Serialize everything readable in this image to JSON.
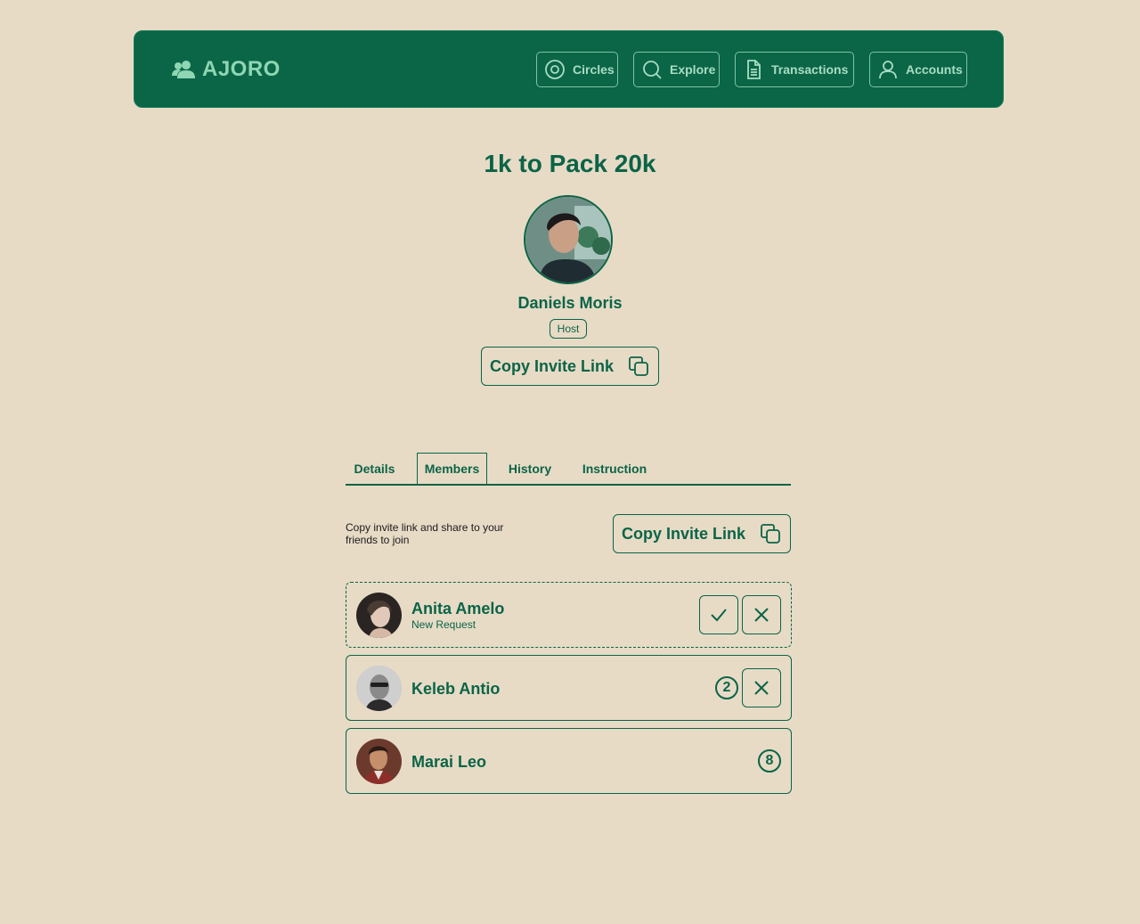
{
  "brand": {
    "name": "AJORO",
    "icon": "users-icon"
  },
  "nav": [
    {
      "label": "Circles",
      "icon": "circle-target-icon"
    },
    {
      "label": "Explore",
      "icon": "search-icon"
    },
    {
      "label": "Transactions",
      "icon": "document-icon"
    },
    {
      "label": "Accounts",
      "icon": "user-icon"
    }
  ],
  "circle": {
    "title": "1k to Pack 20k",
    "host_name": "Daniels Moris",
    "host_badge": "Host",
    "copy_invite_label": "Copy Invite Link"
  },
  "tabs": [
    {
      "label": "Details",
      "active": false
    },
    {
      "label": "Members",
      "active": true
    },
    {
      "label": "History",
      "active": false
    },
    {
      "label": "Instruction",
      "active": false
    }
  ],
  "members_panel": {
    "invite_hint": "Copy invite link and share to your friends to join",
    "copy_invite_label": "Copy Invite Link"
  },
  "members": [
    {
      "name": "Anita Amelo",
      "status": "New Request",
      "position": null
    },
    {
      "name": "Keleb Antio",
      "status": "",
      "position": "2"
    },
    {
      "name": "Marai Leo",
      "status": "",
      "position": "8"
    }
  ],
  "colors": {
    "background": "#e7dbc6",
    "primary": "#0b6447",
    "nav_text": "#a9dcc3"
  }
}
